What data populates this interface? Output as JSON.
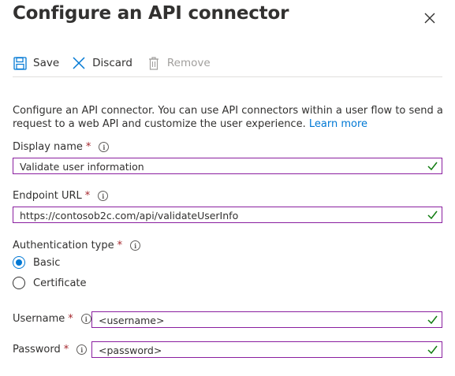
{
  "panel": {
    "title": "Configure an API connector"
  },
  "toolbar": {
    "save_label": "Save",
    "discard_label": "Discard",
    "remove_label": "Remove"
  },
  "description": {
    "text": "Configure an API connector. You can use API connectors within a user flow to send a request to a web API and customize the user experience.",
    "link_text": "Learn more"
  },
  "form": {
    "required_marker": "*",
    "info_glyph": "i",
    "display_name": {
      "label": "Display name",
      "value": "Validate user information"
    },
    "endpoint_url": {
      "label": "Endpoint URL",
      "value": "https://contosob2c.com/api/validateUserInfo"
    },
    "authentication_type": {
      "label": "Authentication type",
      "options": [
        "Basic",
        "Certificate"
      ],
      "selected": "Basic"
    },
    "username": {
      "label": "Username",
      "value": "<username>"
    },
    "password": {
      "label": "Password",
      "value": "<password>"
    }
  },
  "colors": {
    "accent": "#0078d4",
    "field_border": "#8a1f9f",
    "valid_check": "#107c10",
    "required": "#a4262c",
    "disabled": "#a19f9d"
  }
}
